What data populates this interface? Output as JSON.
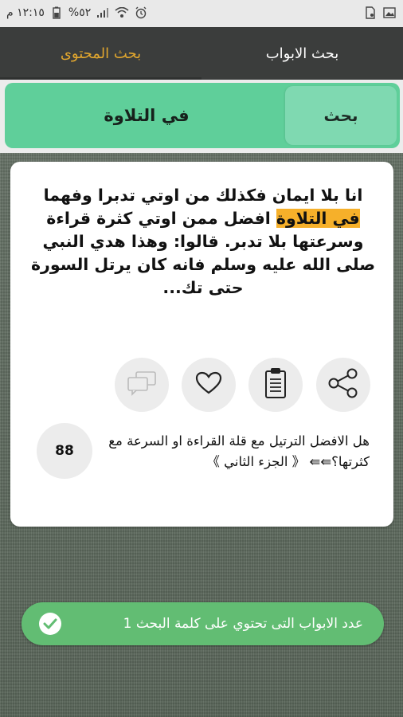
{
  "status_bar": {
    "time": "١٢:١٥ م",
    "battery": "%٥٢"
  },
  "tabs": [
    {
      "label": "بحث الابواب",
      "selected": false
    },
    {
      "label": "بحث المحتوى",
      "selected": true
    }
  ],
  "search": {
    "button_label": "بحث",
    "query": "في التلاوة"
  },
  "result": {
    "text_before": "انا بلا ايمان فكذلك من اوتي تدبرا وفهما ",
    "highlight": "في التلاوة",
    "text_after": " افضل ممن اوتي كثرة قراءة وسرعتها بلا تدبر. قالوا: وهذا هدي النبي صلى الله عليه وسلم فانه كان يرتل السورة حتى تك...",
    "chapter_title": "هل الافضل الترتيل مع قلة القراءة او السرعة مع كثرتها؟⇚⇚ 《 الجزء الثاني 》",
    "number": "88"
  },
  "icons": [
    "share-icon",
    "clipboard-icon",
    "heart-icon",
    "comment-icon"
  ],
  "toast": {
    "message": "عدد الابواب التى تحتوي على كلمة البحث 1"
  },
  "colors": {
    "accent_tab": "#e2a72e",
    "search_bar": "#5fcf9a",
    "highlight": "#f6b02a",
    "toast": "#62bd73"
  }
}
